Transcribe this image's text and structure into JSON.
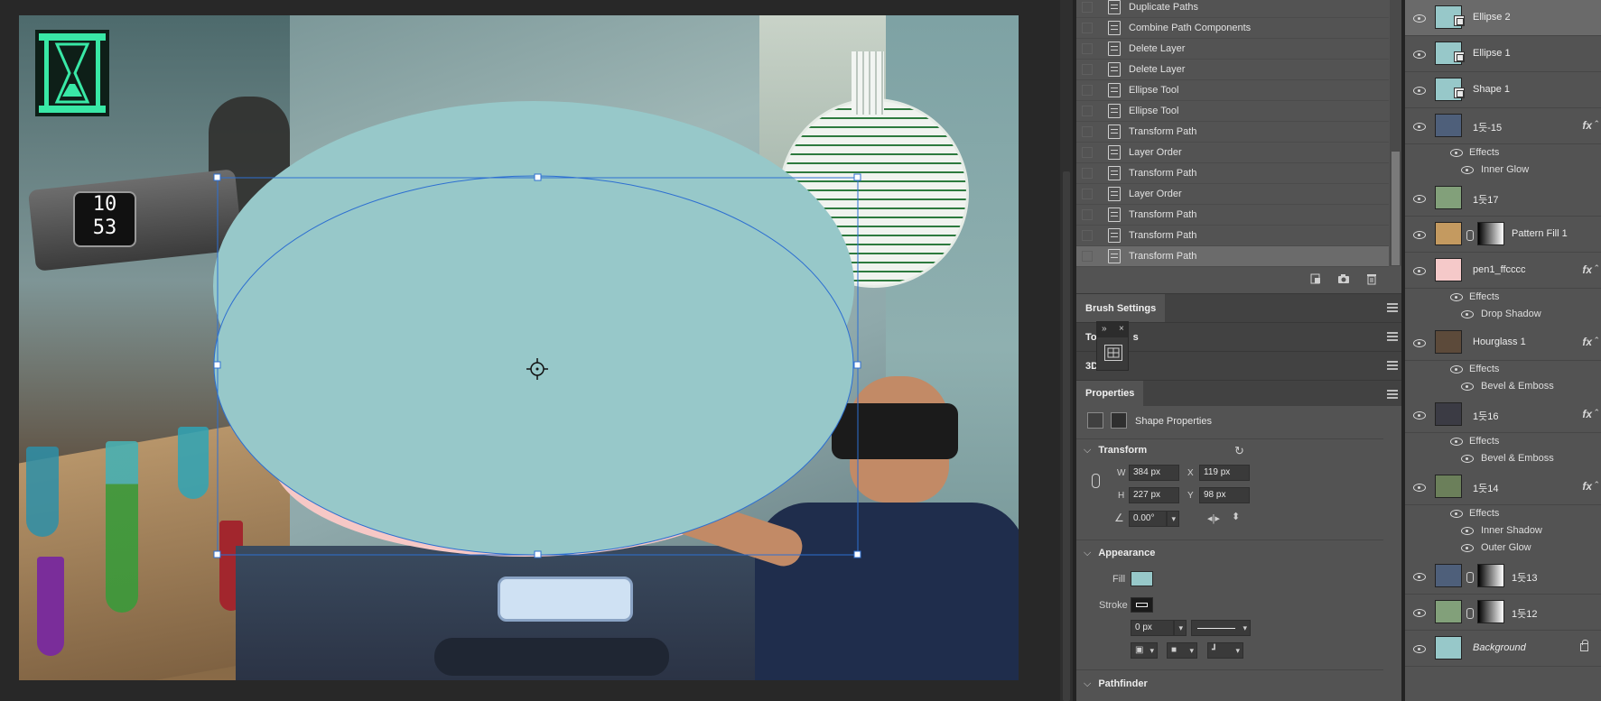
{
  "history": {
    "items": [
      {
        "label": "Duplicate Paths"
      },
      {
        "label": "Combine Path Components"
      },
      {
        "label": "Delete Layer"
      },
      {
        "label": "Delete Layer"
      },
      {
        "label": "Ellipse Tool"
      },
      {
        "label": "Ellipse Tool"
      },
      {
        "label": "Transform Path"
      },
      {
        "label": "Layer Order"
      },
      {
        "label": "Transform Path"
      },
      {
        "label": "Layer Order"
      },
      {
        "label": "Transform Path"
      },
      {
        "label": "Transform Path"
      },
      {
        "label": "Transform Path"
      }
    ],
    "footer_icons": [
      "new-document-from-state-icon",
      "camera-icon",
      "trash-icon"
    ]
  },
  "panels": {
    "brush_settings": "Brush Settings",
    "tool_presets_prefix": "To",
    "tool_presets_suffix": "s",
    "threed": "3D"
  },
  "properties": {
    "tab": "Properties",
    "shape_properties": "Shape Properties",
    "transform": {
      "title": "Transform",
      "w_label": "W",
      "w_value": "384 px",
      "x_label": "X",
      "x_value": "119 px",
      "h_label": "H",
      "h_value": "227 px",
      "y_label": "Y",
      "y_value": "98 px",
      "angle_value": "0.00°"
    },
    "appearance": {
      "title": "Appearance",
      "fill_label": "Fill",
      "fill_color": "#97c8c9",
      "stroke_label": "Stroke",
      "stroke_width": "0 px"
    },
    "pathfinder": {
      "title": "Pathfinder"
    }
  },
  "layers": [
    {
      "name": "Ellipse 2",
      "type": "shape",
      "selected": true,
      "thumb": "#97c8c9"
    },
    {
      "name": "Ellipse 1",
      "type": "shape",
      "thumb": "#97c8c9"
    },
    {
      "name": "Shape 1",
      "type": "shape",
      "thumb": "#97c8c9"
    },
    {
      "name": "1듯-15",
      "fx": "fx",
      "effects_label": "Effects",
      "effects": [
        "Inner Glow"
      ]
    },
    {
      "name": "1듯17"
    },
    {
      "name": "Pattern Fill 1",
      "mask": true
    },
    {
      "name": "pen1_ffcccc",
      "fx": "fx",
      "effects_label": "Effects",
      "effects": [
        "Drop Shadow"
      ],
      "thumb": "#f5c9c9"
    },
    {
      "name": "Hourglass 1",
      "fx": "fx",
      "effects_label": "Effects",
      "effects": [
        "Bevel & Emboss"
      ]
    },
    {
      "name": "1듯16",
      "fx": "fx",
      "effects_label": "Effects",
      "effects": [
        "Bevel & Emboss"
      ]
    },
    {
      "name": "1듯14",
      "fx": "fx",
      "effects_label": "Effects",
      "effects": [
        "Inner Shadow",
        "Outer Glow"
      ]
    },
    {
      "name": "1듯13",
      "mask": true
    },
    {
      "name": "1듯12",
      "mask": true
    },
    {
      "name": "Background",
      "thumb": "#97c8c9",
      "locked": true
    }
  ],
  "canvas": {
    "watch_time_top": "10",
    "watch_time_bottom": "53",
    "ellipse_color": "#97c8c9",
    "selection_color": "#2d6fd1"
  }
}
